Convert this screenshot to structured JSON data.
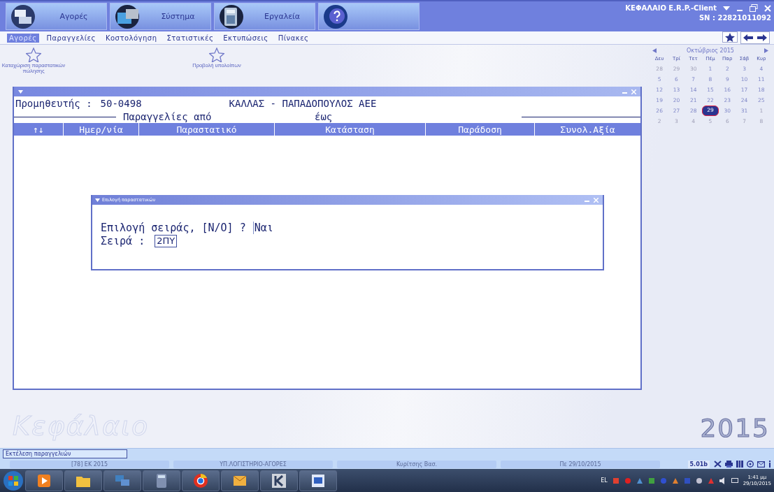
{
  "header": {
    "modules": [
      {
        "label": "Αγορές"
      },
      {
        "label": "Σύστημα"
      },
      {
        "label": "Εργαλεία"
      }
    ],
    "app_title": "ΚΕΦΑΛΑΙΟ E.R.P.-Client",
    "serial": "SN : 22821011092"
  },
  "menu": [
    {
      "label": "Αγορές",
      "selected": true
    },
    {
      "label": "Παραγγελίες",
      "selected": false
    },
    {
      "label": "Κοστολόγηση",
      "selected": false
    },
    {
      "label": "Στατιστικές",
      "selected": false
    },
    {
      "label": "Εκτυπώσεις",
      "selected": false
    },
    {
      "label": "Πίνακες",
      "selected": false
    }
  ],
  "shortcuts": [
    {
      "label": "Καταχώριση παραστατικών πώλησης"
    },
    {
      "label": "Προβολή υπολοίπων"
    }
  ],
  "window": {
    "supplier_label": "Προμηθευτής :",
    "supplier_code": "50-0498",
    "supplier_name": "ΚΑΛΛΑΣ - ΠΑΠΑΔΟΠΟΥΛΟΣ ΑΕΕ",
    "range_from": "Παραγγελίες από",
    "range_to": "έως",
    "columns": [
      "↑↓",
      "Ημερ/νία",
      "Παραστατικό",
      "Κατάσταση",
      "Παράδοση",
      "Συνολ.Αξία"
    ]
  },
  "dialog": {
    "title": "Επιλογή παραστατικών",
    "question": "Επιλογή σειράς, [Ν/Ο] ?",
    "answer": "Ναι",
    "series_label": "Σειρά :",
    "series_value": "2ΠΥ"
  },
  "calendar": {
    "month": "Οκτώβριος 2015",
    "weekdays": [
      "Δευ",
      "Τρί",
      "Τετ",
      "Πέμ",
      "Παρ",
      "Σάβ",
      "Κυρ"
    ],
    "days": [
      {
        "d": "28",
        "other_month": true,
        "selected": false
      },
      {
        "d": "29",
        "other_month": true,
        "selected": false
      },
      {
        "d": "30",
        "other_month": true,
        "selected": false
      },
      {
        "d": "1",
        "other_month": false,
        "selected": false
      },
      {
        "d": "2",
        "other_month": false,
        "selected": false
      },
      {
        "d": "3",
        "other_month": false,
        "selected": false
      },
      {
        "d": "4",
        "other_month": false,
        "selected": false
      },
      {
        "d": "5",
        "other_month": false,
        "selected": false
      },
      {
        "d": "6",
        "other_month": false,
        "selected": false
      },
      {
        "d": "7",
        "other_month": false,
        "selected": false
      },
      {
        "d": "8",
        "other_month": false,
        "selected": false
      },
      {
        "d": "9",
        "other_month": false,
        "selected": false
      },
      {
        "d": "10",
        "other_month": false,
        "selected": false
      },
      {
        "d": "11",
        "other_month": false,
        "selected": false
      },
      {
        "d": "12",
        "other_month": false,
        "selected": false
      },
      {
        "d": "13",
        "other_month": false,
        "selected": false
      },
      {
        "d": "14",
        "other_month": false,
        "selected": false
      },
      {
        "d": "15",
        "other_month": false,
        "selected": false
      },
      {
        "d": "16",
        "other_month": false,
        "selected": false
      },
      {
        "d": "17",
        "other_month": false,
        "selected": false
      },
      {
        "d": "18",
        "other_month": false,
        "selected": false
      },
      {
        "d": "19",
        "other_month": false,
        "selected": false
      },
      {
        "d": "20",
        "other_month": false,
        "selected": false
      },
      {
        "d": "21",
        "other_month": false,
        "selected": false
      },
      {
        "d": "22",
        "other_month": false,
        "selected": false
      },
      {
        "d": "23",
        "other_month": false,
        "selected": false
      },
      {
        "d": "24",
        "other_month": false,
        "selected": false
      },
      {
        "d": "25",
        "other_month": false,
        "selected": false
      },
      {
        "d": "26",
        "other_month": false,
        "selected": false
      },
      {
        "d": "27",
        "other_month": false,
        "selected": false
      },
      {
        "d": "28",
        "other_month": false,
        "selected": false
      },
      {
        "d": "29",
        "other_month": false,
        "selected": true
      },
      {
        "d": "30",
        "other_month": false,
        "selected": false
      },
      {
        "d": "31",
        "other_month": false,
        "selected": false
      },
      {
        "d": "1",
        "other_month": true,
        "selected": false
      },
      {
        "d": "2",
        "other_month": true,
        "selected": false
      },
      {
        "d": "3",
        "other_month": true,
        "selected": false
      },
      {
        "d": "4",
        "other_month": true,
        "selected": false
      },
      {
        "d": "5",
        "other_month": true,
        "selected": false
      },
      {
        "d": "6",
        "other_month": true,
        "selected": false
      },
      {
        "d": "7",
        "other_month": true,
        "selected": false
      },
      {
        "d": "8",
        "other_month": true,
        "selected": false
      }
    ]
  },
  "brand": {
    "logo": "Κεφάλαιο",
    "year": "2015"
  },
  "status": {
    "task": "Εκτέλεση παραγγελιών",
    "cells": [
      "[78] ΕΚ 2015",
      "ΥΠ.ΛΟΓΙΣΤΗΡΙΟ-ΑΓΟΡΕΣ",
      "Κυρίτσης Βασ.",
      "Πε 29/10/2015"
    ],
    "version": "5.01b"
  },
  "taskbar": {
    "language": "EL",
    "time": "1:41 μμ",
    "date": "29/10/2015"
  }
}
